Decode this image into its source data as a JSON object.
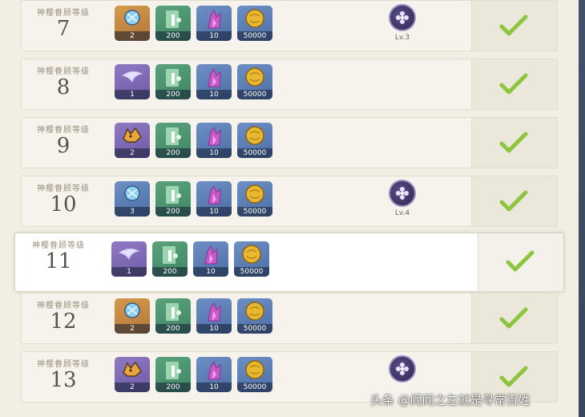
{
  "rows": [
    {
      "caption": "神樱眷顾等级",
      "level": "7",
      "items": [
        {
          "icon": "dew-icon",
          "quality": "orange",
          "qty": "2"
        },
        {
          "icon": "talent-book-icon",
          "quality": "green",
          "qty": "200"
        },
        {
          "icon": "crystal-icon",
          "quality": "blue",
          "qty": "10"
        },
        {
          "icon": "mora-coin-icon",
          "quality": "blue",
          "qty": "50000"
        }
      ],
      "token": "Lv.3",
      "claimed": true
    },
    {
      "caption": "神樱眷顾等级",
      "level": "8",
      "items": [
        {
          "icon": "wing-icon",
          "quality": "purple",
          "qty": "1"
        },
        {
          "icon": "talent-book-icon",
          "quality": "green",
          "qty": "200"
        },
        {
          "icon": "crystal-icon",
          "quality": "blue",
          "qty": "10"
        },
        {
          "icon": "mora-coin-icon",
          "quality": "blue",
          "qty": "50000"
        }
      ],
      "token": null,
      "claimed": true
    },
    {
      "caption": "神樱眷顾等级",
      "level": "9",
      "items": [
        {
          "icon": "fox-icon",
          "quality": "purple",
          "qty": "2"
        },
        {
          "icon": "talent-book-icon",
          "quality": "green",
          "qty": "200"
        },
        {
          "icon": "crystal-icon",
          "quality": "blue",
          "qty": "10"
        },
        {
          "icon": "mora-coin-icon",
          "quality": "blue",
          "qty": "50000"
        }
      ],
      "token": null,
      "claimed": true
    },
    {
      "caption": "神樱眷顾等级",
      "level": "10",
      "items": [
        {
          "icon": "dew-icon",
          "quality": "blue",
          "qty": "3"
        },
        {
          "icon": "talent-book-icon",
          "quality": "green",
          "qty": "200"
        },
        {
          "icon": "crystal-icon",
          "quality": "blue",
          "qty": "10"
        },
        {
          "icon": "mora-coin-icon",
          "quality": "blue",
          "qty": "50000"
        }
      ],
      "token": "Lv.4",
      "claimed": true
    },
    {
      "caption": "神樱眷顾等级",
      "level": "11",
      "items": [
        {
          "icon": "wing-icon",
          "quality": "purple",
          "qty": "1"
        },
        {
          "icon": "talent-book-icon",
          "quality": "green",
          "qty": "200"
        },
        {
          "icon": "crystal-icon",
          "quality": "blue",
          "qty": "10"
        },
        {
          "icon": "mora-coin-icon",
          "quality": "blue",
          "qty": "50000"
        }
      ],
      "token": null,
      "claimed": true,
      "selected": true
    },
    {
      "caption": "神樱眷顾等级",
      "level": "12",
      "items": [
        {
          "icon": "dew-icon",
          "quality": "orange",
          "qty": "2"
        },
        {
          "icon": "talent-book-icon",
          "quality": "green",
          "qty": "200"
        },
        {
          "icon": "crystal-icon",
          "quality": "blue",
          "qty": "10"
        },
        {
          "icon": "mora-coin-icon",
          "quality": "blue",
          "qty": "50000"
        }
      ],
      "token": null,
      "claimed": true
    },
    {
      "caption": "神樱眷顾等级",
      "level": "13",
      "items": [
        {
          "icon": "fox-icon",
          "quality": "purple",
          "qty": "2"
        },
        {
          "icon": "talent-book-icon",
          "quality": "green",
          "qty": "200"
        },
        {
          "icon": "crystal-icon",
          "quality": "blue",
          "qty": "10"
        },
        {
          "icon": "mora-coin-icon",
          "quality": "blue",
          "qty": "50000"
        }
      ],
      "token": "",
      "claimed": true
    }
  ],
  "colors": {
    "check": "#8cc63f",
    "panel": "#f2eee3",
    "token_ring": "#9b91c4"
  },
  "watermark": "头条 @阎阎之左就是寻常百姓"
}
